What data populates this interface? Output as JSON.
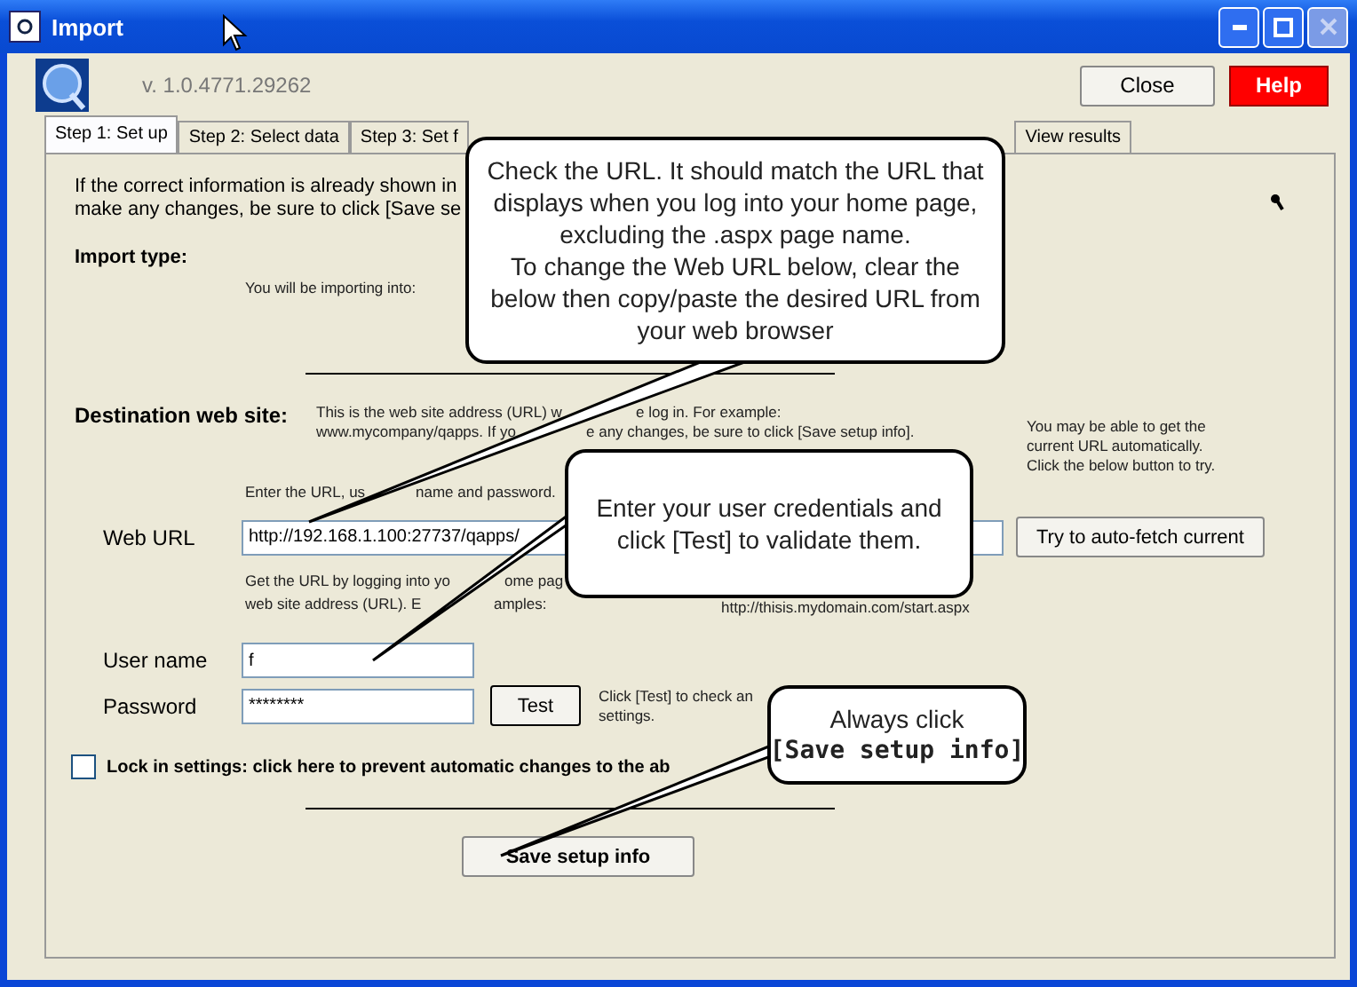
{
  "window": {
    "title": "Import",
    "close_disabled": true
  },
  "header": {
    "version": "v. 1.0.4771.29262",
    "buttons": [
      {
        "label": "Close",
        "kind": "normal"
      },
      {
        "label": "Help",
        "kind": "danger"
      }
    ]
  },
  "tabs": [
    {
      "label": "Step 1: Set up",
      "selected": true
    },
    {
      "label": "Step 2: Select data",
      "selected": false
    },
    {
      "label": "Step 3: Set f",
      "selected": false
    },
    {
      "label": "View results",
      "selected": false
    }
  ],
  "intro": [
    "If the correct information is already shown in",
    "make any changes, be sure to click [Save se"
  ],
  "import_type": {
    "heading": "Import type:",
    "note": "You will be importing into:"
  },
  "destination": {
    "heading": "Destination web site:",
    "description": [
      [
        "This is the web site address (URL) w",
        "e log in. For example:"
      ],
      [
        "www.mycompany/qapps. If yo",
        "e any changes, be sure to click [Save setup info]."
      ]
    ],
    "auto_fetch_hint": [
      "You may be able to get the",
      "current URL automatically.",
      "Click the below button to try."
    ],
    "enter_hint": [
      "Enter the URL, us",
      "name and password."
    ],
    "web_url": {
      "label": "Web URL",
      "value": "http://192.168.1.100:27737/qapps/"
    },
    "auto_fetch_button": "Try to auto-fetch current",
    "get_url_hint": [
      [
        "Get the URL by logging into yo",
        "ome pag"
      ],
      [
        "web site address (URL). E",
        "amples:"
      ]
    ],
    "example_url": "http://thisis.mydomain.com/start.aspx",
    "user_name": {
      "label": "User name",
      "value": "f"
    },
    "password": {
      "label": "Password",
      "value": "********"
    },
    "test_button": "Test",
    "test_hint": [
      "Click [Test] to check an",
      "settings."
    ]
  },
  "lock": {
    "label": "Lock in settings: click here to prevent automatic changes to the ab",
    "checked": false
  },
  "save_button": "Save setup info",
  "callouts": [
    {
      "lines": [
        {
          "text": "Check the URL. It should match the URL that",
          "bold": false
        },
        {
          "text": "displays when you log into your home page,",
          "bold": false
        },
        {
          "text": "excluding the .aspx page name.",
          "bold": false
        },
        {
          "text": "To change the Web URL below, clear the",
          "bold": false
        },
        {
          "text": "below then copy/paste the desired URL from",
          "bold": false
        },
        {
          "text": "your web browser",
          "bold": false
        }
      ]
    },
    {
      "lines": [
        {
          "text": "Enter your user credentials and",
          "bold": false
        },
        {
          "text": "click [Test] to validate them.",
          "bold": false
        }
      ]
    },
    {
      "lines": [
        {
          "text": "Always click",
          "bold": false
        },
        {
          "text": "[Save setup info]",
          "bold": true
        }
      ]
    }
  ]
}
